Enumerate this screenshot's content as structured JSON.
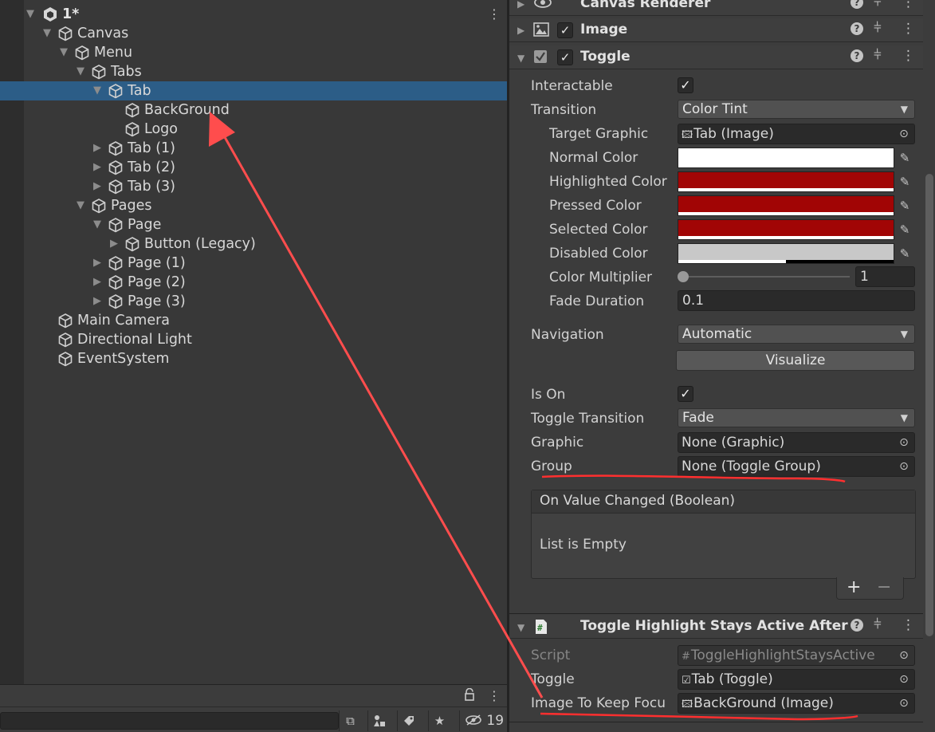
{
  "hierarchy": {
    "scene_name": "1*",
    "items": [
      {
        "label": "Canvas",
        "depth": 1,
        "fold": "expanded",
        "selected": false
      },
      {
        "label": "Menu",
        "depth": 2,
        "fold": "expanded",
        "selected": false
      },
      {
        "label": "Tabs",
        "depth": 3,
        "fold": "expanded",
        "selected": false
      },
      {
        "label": "Tab",
        "depth": 4,
        "fold": "expanded",
        "selected": true
      },
      {
        "label": "BackGround",
        "depth": 5,
        "fold": "none",
        "selected": false
      },
      {
        "label": "Logo",
        "depth": 5,
        "fold": "none",
        "selected": false
      },
      {
        "label": "Tab (1)",
        "depth": 4,
        "fold": "collapsed",
        "selected": false
      },
      {
        "label": "Tab (2)",
        "depth": 4,
        "fold": "collapsed",
        "selected": false
      },
      {
        "label": "Tab (3)",
        "depth": 4,
        "fold": "collapsed",
        "selected": false
      },
      {
        "label": "Pages",
        "depth": 3,
        "fold": "expanded",
        "selected": false
      },
      {
        "label": "Page",
        "depth": 4,
        "fold": "expanded",
        "selected": false
      },
      {
        "label": "Button (Legacy)",
        "depth": 5,
        "fold": "collapsed",
        "selected": false
      },
      {
        "label": "Page (1)",
        "depth": 4,
        "fold": "collapsed",
        "selected": false
      },
      {
        "label": "Page (2)",
        "depth": 4,
        "fold": "collapsed",
        "selected": false
      },
      {
        "label": "Page (3)",
        "depth": 4,
        "fold": "collapsed",
        "selected": false
      },
      {
        "label": "Main Camera",
        "depth": 1,
        "fold": "none",
        "selected": false
      },
      {
        "label": "Directional Light",
        "depth": 1,
        "fold": "none",
        "selected": false
      },
      {
        "label": "EventSystem",
        "depth": 1,
        "fold": "none",
        "selected": false
      }
    ],
    "toolbar": {
      "hidden_count": "19",
      "icons": [
        "lock-icon",
        "scene-visibility-icon",
        "search-by-type-icon",
        "label-icon",
        "favorite-star-icon",
        "hidden-objects-icon"
      ]
    }
  },
  "inspector": {
    "components": {
      "canvas_renderer": {
        "title": "Canvas Renderer"
      },
      "image": {
        "title": "Image",
        "enabled": true
      },
      "toggle": {
        "title": "Toggle",
        "enabled": true
      },
      "script": {
        "title": "Toggle Highlight Stays Active After"
      }
    },
    "toggle": {
      "interactable_label": "Interactable",
      "interactable": true,
      "transition_label": "Transition",
      "transition_value": "Color Tint",
      "target_graphic_label": "Target Graphic",
      "target_graphic_value": "Tab (Image)",
      "normal_color_label": "Normal Color",
      "normal_color": "#ffffff",
      "highlighted_color_label": "Highlighted Color",
      "highlighted_color": "#a10505",
      "pressed_color_label": "Pressed Color",
      "pressed_color": "#a10505",
      "selected_color_label": "Selected Color",
      "selected_color": "#a10505",
      "disabled_color_label": "Disabled Color",
      "disabled_color": "#c8c8c8",
      "disabled_alpha": 0.5,
      "color_multiplier_label": "Color Multiplier",
      "color_multiplier_value": "1",
      "color_multiplier_slider": 0,
      "fade_duration_label": "Fade Duration",
      "fade_duration_value": "0.1",
      "navigation_label": "Navigation",
      "navigation_value": "Automatic",
      "visualize_label": "Visualize",
      "is_on_label": "Is On",
      "is_on": true,
      "toggle_transition_label": "Toggle Transition",
      "toggle_transition_value": "Fade",
      "graphic_label": "Graphic",
      "graphic_value": "None (Graphic)",
      "group_label": "Group",
      "group_value": "None (Toggle Group)",
      "event_title": "On Value Changed (Boolean)",
      "event_empty": "List is Empty",
      "add_label": "+",
      "remove_label": "−"
    },
    "script": {
      "script_label": "Script",
      "script_value": "ToggleHighlightStaysActive",
      "toggle_label": "Toggle",
      "toggle_value": "Tab (Toggle)",
      "image_label": "Image To Keep Focu",
      "image_value": "BackGround (Image)"
    }
  },
  "colors": {
    "selection": "#2c5d87",
    "annotation": "#ff4444",
    "panel": "#383838"
  }
}
